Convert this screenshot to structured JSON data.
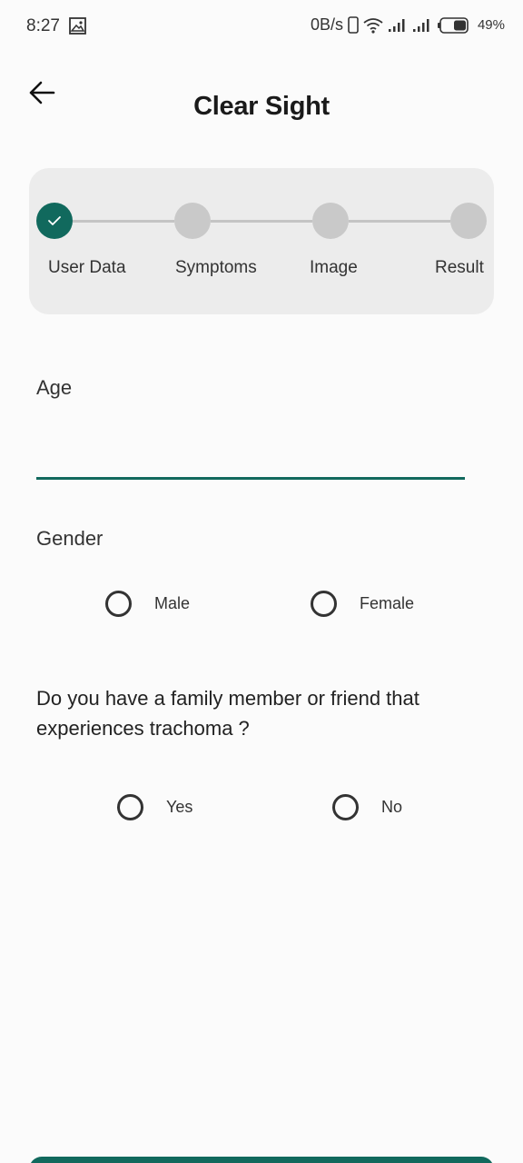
{
  "status_bar": {
    "time": "8:27",
    "net_speed": "0B/s",
    "battery": "49%"
  },
  "header": {
    "title": "Clear Sight"
  },
  "stepper": {
    "steps": [
      {
        "label": "User Data",
        "done": true
      },
      {
        "label": "Symptoms",
        "done": false
      },
      {
        "label": "Image",
        "done": false
      },
      {
        "label": "Result",
        "done": false
      }
    ]
  },
  "form": {
    "age_label": "Age",
    "age_value": "",
    "gender_label": "Gender",
    "gender_options": [
      "Male",
      "Female"
    ],
    "question": "Do you have a family member or friend that experiences trachoma ?",
    "question_options": [
      "Yes",
      "No"
    ]
  },
  "colors": {
    "accent": "#11695d",
    "stepper_bg": "#ececec",
    "pending_dot": "#c9c9c9"
  }
}
